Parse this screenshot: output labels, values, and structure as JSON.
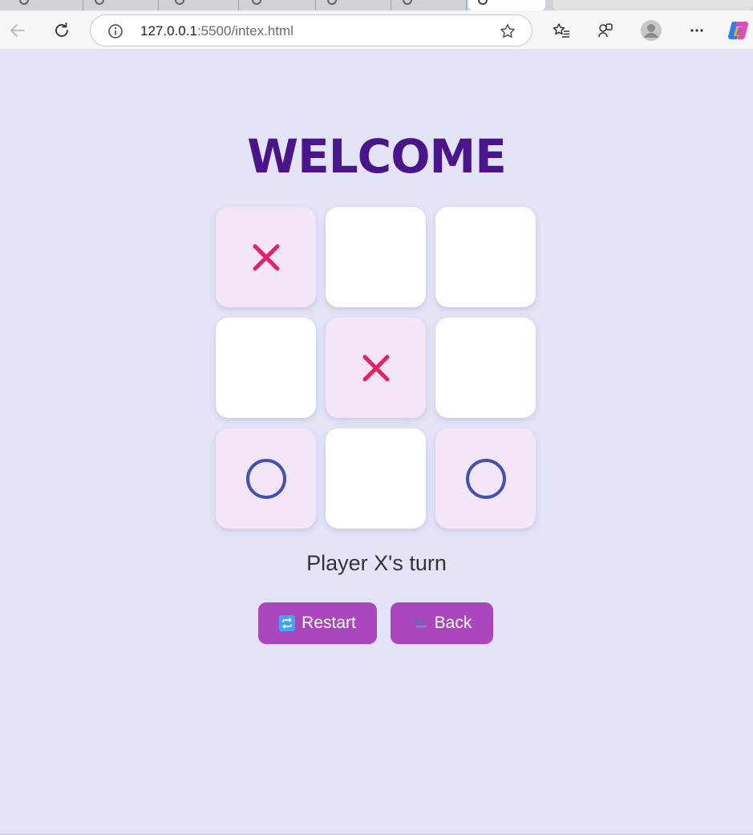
{
  "browser": {
    "url_host": "127.0.0.1",
    "url_path": ":5500/intex.html"
  },
  "page": {
    "title": "WELCOME",
    "status": "Player X's turn"
  },
  "board": [
    "X",
    "",
    "",
    "",
    "X",
    "",
    "O",
    "",
    "O"
  ],
  "buttons": {
    "restart_label": "Restart",
    "back_label": "Back"
  },
  "colors": {
    "background": "#e4e4f8",
    "title": "#4a148c",
    "x_mark": "#e91e63",
    "o_mark": "#3f51b5",
    "filled_cell": "#f3e6f6",
    "button": "#ab47bc"
  },
  "icons": {
    "restart": "repeat-arrows-icon",
    "back": "back-arrow-icon"
  }
}
